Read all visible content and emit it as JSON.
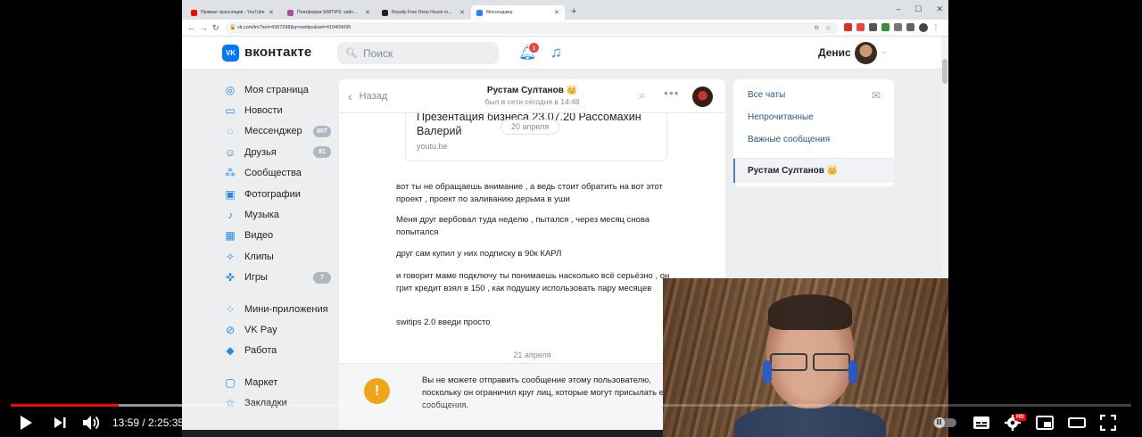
{
  "browser": {
    "tabs": [
      {
        "title": "Прямые трансляции - YouTube",
        "color": "#ff0000",
        "active": false
      },
      {
        "title": "Платформа SWITIPS: хайп...",
        "color": "#a64ca6",
        "active": false
      },
      {
        "title": "Royalty Free Deep House m...",
        "color": "#222222",
        "active": false
      },
      {
        "title": "Мессенджер",
        "color": "#2787f5",
        "active": true
      }
    ],
    "new_tab": "+",
    "url": "vk.com/im?sel=4397298&q=switips&sel=419409095"
  },
  "vk": {
    "brand": "вконтакте",
    "logo_text": "VK",
    "search_placeholder": "Поиск",
    "notification_count": "1",
    "user_name": "Денис",
    "nav": [
      {
        "label": "Моя страница",
        "icon": "user-icon",
        "badge": ""
      },
      {
        "label": "Новости",
        "icon": "news-icon",
        "badge": ""
      },
      {
        "label": "Мессенджер",
        "icon": "messenger-icon",
        "badge": "807"
      },
      {
        "label": "Друзья",
        "icon": "friends-icon",
        "badge": "81"
      },
      {
        "label": "Сообщества",
        "icon": "communities-icon",
        "badge": ""
      },
      {
        "label": "Фотографии",
        "icon": "photos-icon",
        "badge": ""
      },
      {
        "label": "Музыка",
        "icon": "music-icon",
        "badge": ""
      },
      {
        "label": "Видео",
        "icon": "video-icon",
        "badge": ""
      },
      {
        "label": "Клипы",
        "icon": "clips-icon",
        "badge": ""
      },
      {
        "label": "Игры",
        "icon": "games-icon",
        "badge": "7"
      }
    ],
    "nav2": [
      {
        "label": "Мини-приложения",
        "icon": "mini-apps-icon"
      },
      {
        "label": "VK Pay",
        "icon": "vkpay-icon"
      },
      {
        "label": "Работа",
        "icon": "work-icon"
      }
    ],
    "nav3": [
      {
        "label": "Маркет",
        "icon": "market-icon"
      },
      {
        "label": "Закладки",
        "icon": "bookmarks-icon"
      }
    ]
  },
  "chat": {
    "back": "Назад",
    "contact": "Рустам Султанов 👑",
    "status": "был в сети сегодня в 14:48",
    "link_title": "Презентация бизнеса 23.07.20 Рассомахин Валерий",
    "link_domain": "youtu.be",
    "date1": "20 апреля",
    "messages": [
      "вот ты не обращаешь внимание , а ведь стоит обратить на вот этот проект , проект по заливанию дерьма в уши",
      "Меня друг вербовал туда неделю , пытался , через месяц снова попытался",
      "друг сам купил у них подписку в 90к КАРЛ",
      "и говорит маме подключу ты понимаешь насколько всё серьёзно , он грит кредит взял в 150 , как подушку использовать пару месяцев",
      "switips 2.0 введи просто"
    ],
    "date2": "21 апреля",
    "restriction": "Вы не можете отправить сообщение этому пользователю, поскольку он ограничил круг лиц, которые могут присылать ему сообщения."
  },
  "right_panel": {
    "all_chats": "Все чаты",
    "unread": "Непрочитанные",
    "important": "Важные сообщения",
    "active_chat": "Рустам Султанов 👑"
  },
  "player": {
    "time": "13:59 / 2:25:35",
    "progress": 0.096,
    "hd": "HD"
  }
}
